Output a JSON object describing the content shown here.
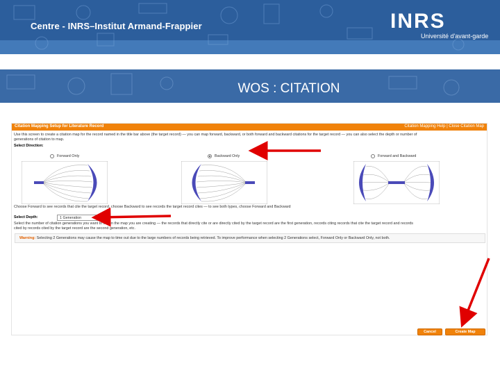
{
  "banner": {
    "title": "Centre - INRS–Institut Armand-Frappier",
    "logo": "INRS",
    "tagline": "Université d'avant-garde"
  },
  "slide_title": "WOS : CITATION",
  "panel": {
    "title": "Citation Mapping Setup for Literature Record",
    "links": "Citation Mapping Help | Close Citation Map",
    "intro_line1": "Use this screen to create a citation map for the record named in the title bar above (the target record) — you can map forward, backward, or both forward and backward citations for the target record — you can also select the depth or number of",
    "intro_line2": "generations of citation to map.",
    "select_direction_label": "Select Direction:",
    "options": [
      {
        "label": "Forward Only",
        "checked": false
      },
      {
        "label": "Backward Only",
        "checked": true
      },
      {
        "label": "Forward and Backward",
        "checked": false
      }
    ],
    "direction_help": "Choose Forward to see records that cite the target record, choose Backward to see records the target record cites — to see both types, choose Forward and Backward",
    "select_depth_label": "Select Depth:",
    "depth_value": "1 Generation",
    "depth_help_line1": "Select the number of citation generations you want to see in the map you are creating — the records that directly cite or are directly cited by the target record are the first generation, records citing records that cite the target record and records",
    "depth_help_line2": "cited by records cited by the target record are the second generation, etc.",
    "warning_label": "Warning:",
    "warning_text": " Selecting 2 Generations may cause the map to time out due to the large numbers of records being retrieved. To improve performance when selecting 2 Generations select, Forward Only or Backward Only, not both.",
    "cancel_label": "Cancel",
    "create_label": "Create Map"
  },
  "colors": {
    "banner": "#2c5e9c",
    "accent_orange": "#f0820a",
    "arrow_red": "#e00000",
    "map_purple": "#4a4ab8"
  }
}
